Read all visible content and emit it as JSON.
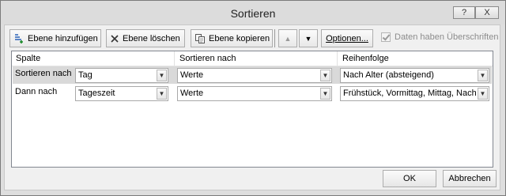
{
  "window": {
    "title": "Sortieren",
    "help_label": "?",
    "close_label": "X"
  },
  "toolbar": {
    "add_level": "Ebene hinzufügen",
    "delete_level": "Ebene löschen",
    "copy_level": "Ebene kopieren",
    "move_up": "▲",
    "move_down": "▼",
    "options": "Optionen...",
    "has_headers_label": "Daten haben Überschriften",
    "has_headers_checked": true,
    "has_headers_enabled": false
  },
  "grid": {
    "headers": {
      "column": "Spalte",
      "sort_on": "Sortieren nach",
      "order": "Reihenfolge"
    },
    "rows": [
      {
        "label": "Sortieren nach",
        "column": "Tag",
        "sort_on": "Werte",
        "order": "Nach Alter (absteigend)",
        "selected": true
      },
      {
        "label": "Dann nach",
        "column": "Tageszeit",
        "sort_on": "Werte",
        "order": "Frühstück, Vormittag, Mittag, Nachmittag",
        "selected": false
      }
    ]
  },
  "footer": {
    "ok": "OK",
    "cancel": "Abbrechen"
  },
  "colors": {
    "selected_row": "#d9d9d9",
    "dialog_bg": "#f0f0f0",
    "disabled_text": "#8c8c8c"
  }
}
